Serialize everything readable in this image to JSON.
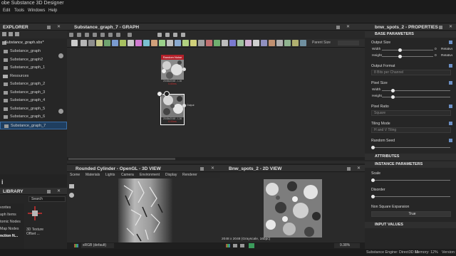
{
  "app": {
    "title": "obe Substance 3D Designer"
  },
  "menu": [
    "Edit",
    "Tools",
    "Windows",
    "Help"
  ],
  "explorer": {
    "title": "EXPLORER",
    "package": "Substance_graph.sbs*",
    "items": [
      {
        "label": "Substance_graph"
      },
      {
        "label": "Substance_graph2"
      },
      {
        "label": "Substance_graph_1"
      },
      {
        "label": "Resources"
      },
      {
        "label": "Substance_graph_2"
      },
      {
        "label": "Substance_graph_3"
      },
      {
        "label": "Substance_graph_4"
      },
      {
        "label": "Substance_graph_5"
      },
      {
        "label": "Substance_graph_6"
      },
      {
        "label": "Substance_graph_7"
      }
    ]
  },
  "library": {
    "title": "LIBRARY",
    "search_placeholder": "Search",
    "categories": [
      "vorites",
      "aph Items",
      "tomic Nodes",
      "Map Nodes",
      "nction N..."
    ],
    "item_label_1": "3D Texture",
    "item_label_2": "Offset ..."
  },
  "graph": {
    "title": "Substance_graph_7 - GRAPH",
    "parent_size_label": "Parent Size",
    "node1": {
      "header": "Random Noise",
      "res": "2048x2048 - L16",
      "time": "0.60ms"
    },
    "node2": {
      "res": "2048x2048 - L16",
      "time": "0.00ms",
      "output_label": "Output"
    }
  },
  "view3d": {
    "title": "Rounded Cylinder - OpenGL - 3D VIEW",
    "menu": [
      "Scene",
      "Materials",
      "Lights",
      "Camera",
      "Environment",
      "Display",
      "Renderer"
    ],
    "colorspace": "sRGB (default)"
  },
  "view2d": {
    "title": "Bnw_spots_2 - 2D VIEW",
    "info": "2048 x 2048 (Grayscale, 16bpc)",
    "zoom": "9.38%"
  },
  "properties": {
    "title": "bnw_spots_2 - PROPERTIES",
    "base_parameters": "BASE PARAMETERS",
    "output_size": "Output Size",
    "width": "Width",
    "height": "Height",
    "output_size_w": "0",
    "output_size_h": "0",
    "relative": "Relative to parent",
    "relative_h": "Relative to parent",
    "output_format": "Output Format",
    "output_format_value": "8 Bits per Channel",
    "pixel_size": "Pixel Size",
    "pixel_ratio": "Pixel Ratio",
    "pixel_ratio_value": "Square",
    "tiling_mode": "Tiling Mode",
    "tiling_mode_value": "H and V Tiling",
    "random_seed": "Random Seed",
    "attributes": "ATTRIBUTES",
    "instance_parameters": "INSTANCE PARAMETERS",
    "scale": "Scale",
    "disorder": "Disorder",
    "non_square": "Non Square Expansion",
    "non_square_value": "True",
    "input_values": "INPUT VALUES"
  },
  "status": {
    "engine": "Substance Engine: Direct3D 11",
    "memory": "Memory: 12%",
    "version": "Version:"
  }
}
